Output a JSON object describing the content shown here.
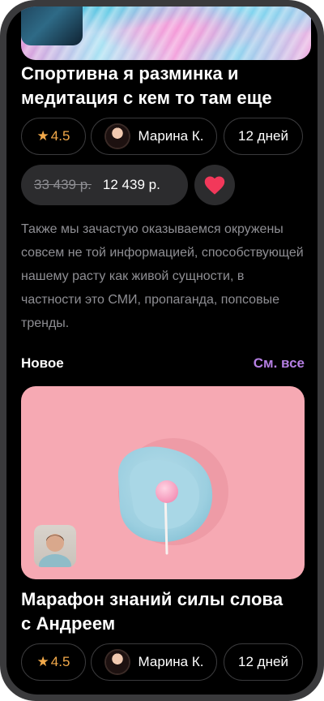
{
  "course_top": {
    "title": "Спортивна я разминка и медитация с кем то там еще",
    "rating": "4.5",
    "author": "Марина  К.",
    "duration": "12 дней",
    "old_price": "33 439 р.",
    "price": "12 439 р.",
    "description": "Также мы зачастую оказываемся окружены совсем не той информацией, способствующей нашему расту как живой сущности, в частности это СМИ, пропаганда, попсовые тренды."
  },
  "section": {
    "title": "Новое",
    "see_all": "См. все"
  },
  "course_new": {
    "title": "Марафон знаний силы слова с Андреем",
    "rating": "4.5",
    "author": "Марина  К.",
    "duration": "12 дней"
  },
  "colors": {
    "background": "#000000",
    "chip_border": "#3a3a3c",
    "pill_bg": "#2c2c2e",
    "rating_accent": "#f2a94a",
    "favorite": "#f2385a",
    "see_all": "#b57fe3",
    "card_bg": "#f6a9b3"
  },
  "icons": {
    "rating": "star-icon",
    "favorite": "heart-icon"
  }
}
